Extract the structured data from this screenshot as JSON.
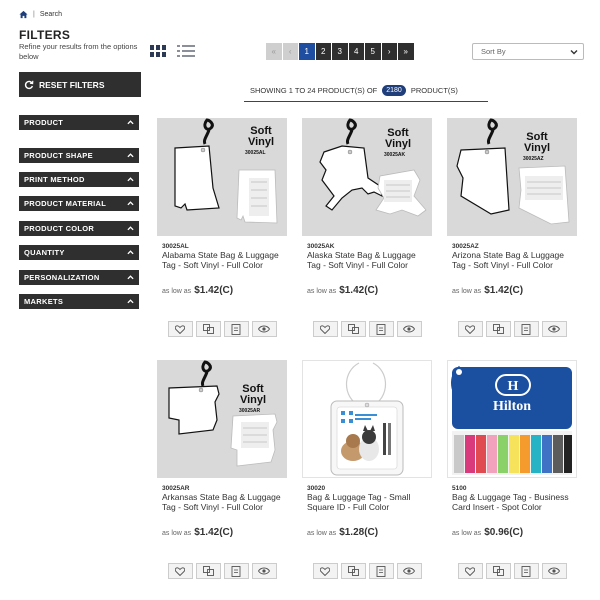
{
  "breadcrumb": {
    "separator": "|",
    "search": "Search"
  },
  "filters": {
    "title": "FILTERS",
    "subtitle": "Refine your results from the options below",
    "reset_label": "RESET FILTERS",
    "groups": [
      "PRODUCT",
      "PRODUCT SHAPE",
      "PRINT METHOD",
      "PRODUCT MATERIAL",
      "PRODUCT COLOR",
      "QUANTITY",
      "PERSONALIZATION",
      "MARKETS"
    ]
  },
  "pagination": {
    "prev_first": "«",
    "prev": "‹",
    "pages": [
      "1",
      "2",
      "3",
      "4",
      "5"
    ],
    "next": "›",
    "last": "»",
    "current": "1"
  },
  "sort": {
    "label": "Sort By"
  },
  "results": {
    "prefix": "SHOWING 1 TO 24 PRODUCT(S) OF",
    "total": "2180",
    "suffix": "PRODUCT(S)"
  },
  "products": [
    {
      "sku": "30025AL",
      "name": "Alabama State Bag & Luggage Tag - Soft Vinyl - Full Color",
      "price_prefix": "as low as",
      "price": "$1.42(C)",
      "tag_text_1": "Soft",
      "tag_text_2": "Vinyl",
      "tag_code": "30025AL"
    },
    {
      "sku": "30025AK",
      "name": "Alaska State Bag & Luggage Tag - Soft Vinyl - Full Color",
      "price_prefix": "as low as",
      "price": "$1.42(C)",
      "tag_text_1": "Soft",
      "tag_text_2": "Vinyl",
      "tag_code": "30025AK"
    },
    {
      "sku": "30025AZ",
      "name": "Arizona State Bag & Luggage Tag - Soft Vinyl - Full Color",
      "price_prefix": "as low as",
      "price": "$1.42(C)",
      "tag_text_1": "Soft",
      "tag_text_2": "Vinyl",
      "tag_code": "30025AZ"
    },
    {
      "sku": "30025AR",
      "name": "Arkansas State Bag & Luggage Tag - Soft Vinyl - Full Color",
      "price_prefix": "as low as",
      "price": "$1.42(C)",
      "tag_text_1": "Soft",
      "tag_text_2": "Vinyl",
      "tag_code": "30025AR"
    },
    {
      "sku": "30020",
      "name": "Bag & Luggage Tag - Small Square ID - Full Color",
      "price_prefix": "as low as",
      "price": "$1.28(C)"
    },
    {
      "sku": "5100",
      "name": "Bag & Luggage Tag - Business Card Insert - Spot Color",
      "price_prefix": "as low as",
      "price": "$0.96(C)",
      "brand": "Hilton"
    }
  ],
  "colors": {
    "dark_button": "#2f2f2f",
    "active_page": "#1f4ea0",
    "count_badge": "#1f3e7a",
    "hilton_blue": "#1b4fa0"
  },
  "icons": [
    "home-icon",
    "refresh-icon",
    "grid-view-icon",
    "list-view-icon",
    "chevron-up-icon",
    "chevron-down-icon",
    "heart-icon",
    "compare-icon",
    "quote-icon",
    "eye-icon"
  ]
}
